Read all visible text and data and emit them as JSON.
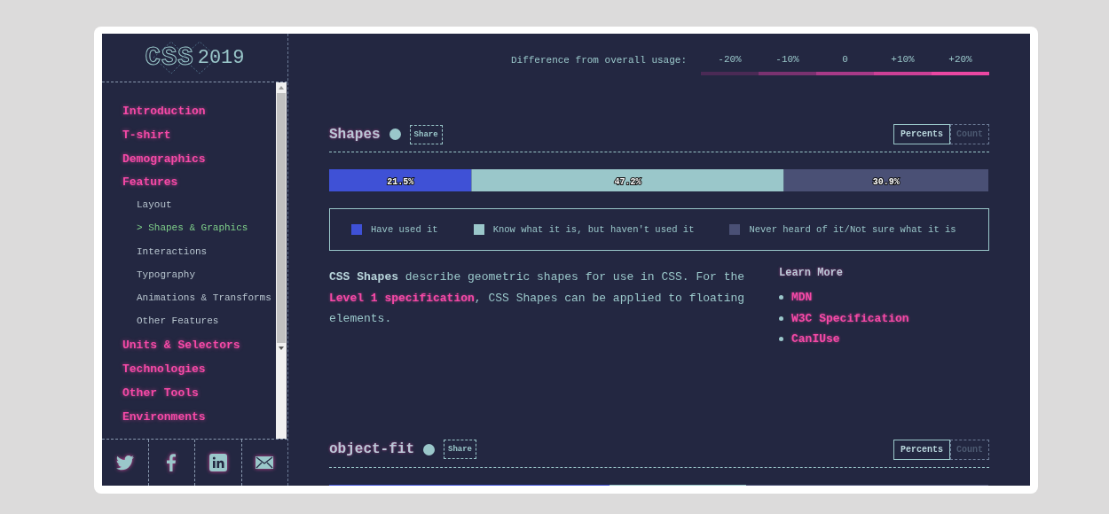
{
  "logo": {
    "wordmark": "CSS",
    "year": "2019"
  },
  "sidebar": {
    "selected_marker": ">",
    "items": [
      {
        "label": "Introduction",
        "selected": false
      },
      {
        "label": "T-shirt",
        "selected": false
      },
      {
        "label": "Demographics",
        "selected": false
      },
      {
        "label": "Features",
        "selected": false,
        "children": [
          {
            "label": "Layout",
            "selected": false
          },
          {
            "label": "Shapes & Graphics",
            "selected": true
          },
          {
            "label": "Interactions",
            "selected": false
          },
          {
            "label": "Typography",
            "selected": false
          },
          {
            "label": "Animations & Transforms",
            "selected": false
          },
          {
            "label": "Other Features",
            "selected": false
          }
        ]
      },
      {
        "label": "Units & Selectors",
        "selected": false
      },
      {
        "label": "Technologies",
        "selected": false
      },
      {
        "label": "Other Tools",
        "selected": false
      },
      {
        "label": "Environments",
        "selected": false
      }
    ]
  },
  "social": [
    {
      "kind": "twitter"
    },
    {
      "kind": "facebook"
    },
    {
      "kind": "linkedin"
    },
    {
      "kind": "mail"
    }
  ],
  "difference_legend": {
    "label": "Difference from overall usage:",
    "steps": [
      {
        "label": "-20%",
        "color": "#4a2a55"
      },
      {
        "label": "-10%",
        "color": "#7a3270"
      },
      {
        "label": "0",
        "color": "#a83a88"
      },
      {
        "label": "+10%",
        "color": "#cc4096"
      },
      {
        "label": "+20%",
        "color": "#ea47a2"
      }
    ]
  },
  "sections": [
    {
      "title": "Shapes",
      "share": "Share",
      "toggle": [
        {
          "label": "Percents",
          "selected": true
        },
        {
          "label": "Count",
          "selected": false
        }
      ],
      "chart_data": {
        "type": "bar",
        "orientation": "horizontal",
        "stacked": true,
        "series": [
          {
            "name": "Have used it",
            "color": "#3f51d6",
            "values": [
              21.5
            ],
            "value_labels": [
              "21.5%"
            ]
          },
          {
            "name": "Know what it is, but haven't used it",
            "color": "#9ac7ca",
            "values": [
              47.2
            ],
            "value_labels": [
              "47.2%"
            ]
          },
          {
            "name": "Never heard of it/Not sure what it is",
            "color": "#4a5075",
            "values": [
              30.9
            ],
            "value_labels": [
              "30.9%"
            ]
          }
        ]
      },
      "description": [
        {
          "kind": "bold",
          "text": "CSS Shapes"
        },
        {
          "kind": "text",
          "text": " describe geometric shapes for use in CSS. For the "
        },
        {
          "kind": "link",
          "text": "Level 1 specification"
        },
        {
          "kind": "text",
          "text": ", CSS Shapes can be applied to floating elements."
        }
      ],
      "learn_more": {
        "title": "Learn More",
        "links": [
          "MDN",
          "W3C Specification",
          "CanIUse"
        ]
      }
    },
    {
      "title": "object-fit",
      "share": "Share",
      "toggle": [
        {
          "label": "Percents",
          "selected": true
        },
        {
          "label": "Count",
          "selected": false
        }
      ]
    }
  ]
}
